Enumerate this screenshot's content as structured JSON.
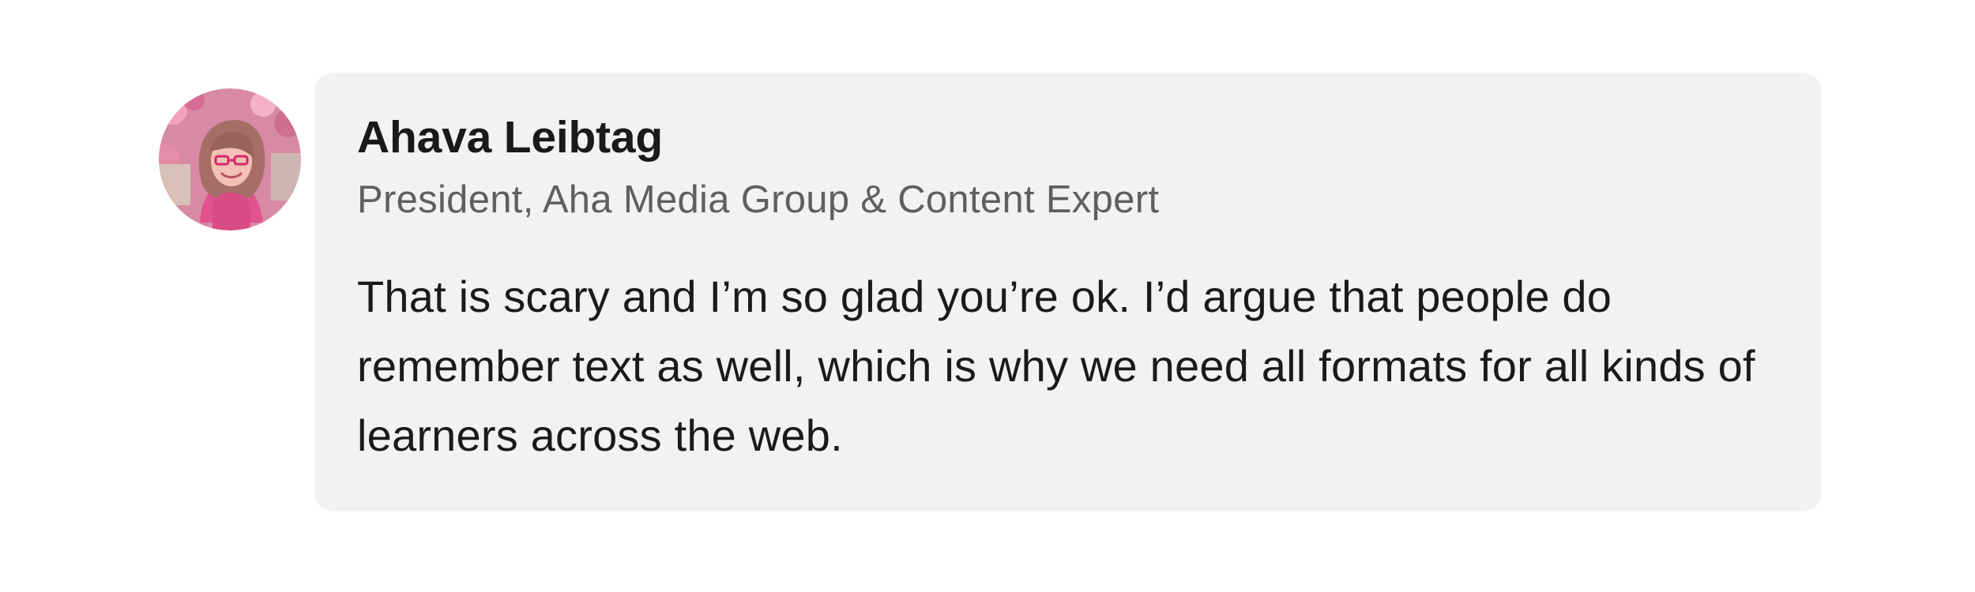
{
  "comment": {
    "author": {
      "name": "Ahava Leibtag",
      "headline": "President, Aha Media Group & Content Expert",
      "avatar_icon": "profile-photo"
    },
    "text": "That is scary and I’m so glad you’re ok. I’d argue that people do remember text as well, which is why we need all formats for all kinds of learners across the web."
  },
  "colors": {
    "bubble_background": "#f2f2f2",
    "name_text": "#1a1a1a",
    "headline_text": "#5f5f5f",
    "body_text": "#1a1a1a"
  }
}
